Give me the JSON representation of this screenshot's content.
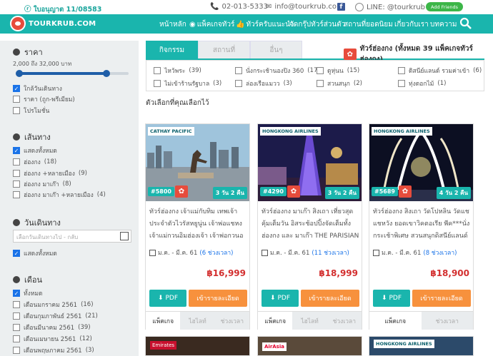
{
  "topbar": {
    "license": "ใบอนุญาต 11/08583",
    "phone": "02-013-5333",
    "email": "info@tourkrub.co",
    "line": "LINE: @tourkrub",
    "add_friends": "Add Friends"
  },
  "nav": {
    "logo_text": "TOURKRUB.COM",
    "items": [
      "หน้าหลัก",
      "แพ็คเกจทัวร์",
      "ทัวร์ครับแนะนำ",
      "จัดกรุ๊ปทัวร์ส่วนตัว",
      "สถานที่ยอดนิยม",
      "เกี่ยวกับเรา",
      "บทความ"
    ]
  },
  "sidebar": {
    "price": {
      "title": "ราคา",
      "range_text": "2,000 ถึง 32,000 บาท",
      "range_min": 2000,
      "range_max": 32000,
      "selected_min": 2000,
      "selected_max": 32000
    },
    "sort_options": [
      {
        "label": "ใกล้วันเดินทาง",
        "checked": true
      },
      {
        "label": "ราคา (ถูก-พรีเมียม)",
        "checked": false
      },
      {
        "label": "โปรโมชั่น",
        "checked": false
      }
    ],
    "route": {
      "title": "เส้นทาง",
      "options": [
        {
          "label": "แสดงทั้งหมด",
          "checked": true
        },
        {
          "label": "ฮ่องกง",
          "count": "(18)",
          "checked": false
        },
        {
          "label": "ฮ่องกง +หลายเมือง",
          "count": "(9)",
          "checked": false
        },
        {
          "label": "ฮ่องกง มาเก๊า",
          "count": "(8)",
          "checked": false
        },
        {
          "label": "ฮ่องกง มาเก๊า +หลายเมือง",
          "count": "(4)",
          "checked": false
        }
      ]
    },
    "date": {
      "title": "วันเดินทาง",
      "placeholder": "เลือกวันเดินทางไป - กลับ",
      "show_all": "แสดงทั้งหมด"
    },
    "month": {
      "title": "เดือน",
      "options": [
        {
          "label": "ทั้งหมด",
          "checked": true
        },
        {
          "label": "เดือนมกราคม 2561",
          "count": "(16)",
          "checked": false
        },
        {
          "label": "เดือนกุมภาพันธ์ 2561",
          "count": "(21)",
          "checked": false
        },
        {
          "label": "เดือนมีนาคม 2561",
          "count": "(39)",
          "checked": false
        },
        {
          "label": "เดือนเมษายน 2561",
          "count": "(12)",
          "checked": false
        },
        {
          "label": "เดือนพฤษภาคม 2561",
          "count": "(3)",
          "checked": false
        }
      ]
    }
  },
  "main": {
    "tabs": [
      "กิจกรรม",
      "สถานที่",
      "อื่นๆ"
    ],
    "heading": "ทัวร์ฮ่องกง (ทั้งหมด 39 แพ็คเกจทัวร์ฮ่องกง)",
    "filters": [
      {
        "label": "ไหว้พระ",
        "count": "(39)"
      },
      {
        "label": "นั่งกระเช้านองปิง 360",
        "count": "(17)"
      },
      {
        "label": "ดูหุ่นน",
        "count": "(15)"
      },
      {
        "label": "ดิสนีย์แลนด์ รวมค่าเข้า",
        "count": "(6)"
      },
      {
        "label": "ไม่เข้าร้านรัฐบาล",
        "count": "(3)"
      },
      {
        "label": "ล่องเรือแมวว",
        "count": "(3)"
      },
      {
        "label": "สวนสนุก",
        "count": "(2)"
      },
      {
        "label": "ทุ่งดอกไม้",
        "count": "(1)"
      }
    ],
    "selected_label": "ตัวเลือกที่คุณเลือกไว้"
  },
  "cards": [
    {
      "code": "#5800",
      "airline": "CATHAY PACIFIC",
      "days": "3 วัน 2 คืน",
      "title": "ทัวร์ฮ่องกง เจ้าแม่กับทิม เทพเจ้าประจำตัวไวรัสหยูนู่น เจ้าพ่อแชหง เจ้าแม่กวนอิมฮ่องเจ้า เจ้าพ่อกวนอ เจ้าแม่กวนอิม...",
      "date_range": "ม.ค. - มี.ค. 61",
      "slots": "(6 ช่วงเวลา)",
      "price": "฿16,999",
      "pdf": "PDF",
      "detail": "เข้ารายละเอียด",
      "tabs": [
        "แพ็คเกจ",
        "ไฮไลท์",
        "ช่วงเวลา"
      ]
    },
    {
      "code": "#4290",
      "airline": "HONGKONG AIRLINES",
      "days": "3 วัน 2 คืน",
      "title": "ทัวร์ฮ่องกง มาเก๊า สิงเถา เที่ยวสุดคุ้มเต็มวัน อิสระช้อปปิ้งจัดเต็มทั้งฮ่องกง และ มาเก๊า THE PARISIAN นมัสการ...",
      "date_range": "ม.ค. - มี.ค. 61",
      "slots": "(11 ช่วงเวลา)",
      "price": "฿18,999",
      "pdf": "PDF",
      "detail": "เข้ารายละเอียด",
      "tabs": [
        "แพ็คเกจ",
        "ไฮไลท์",
        "ช่วงเวลา"
      ]
    },
    {
      "code": "#5689",
      "airline": "HONGKONG AIRLINES",
      "days": "4 วัน 2 คืน",
      "title": "ทัวร์ฮ่องกง สิงเถา วัดโปหลิน วัดแชแชหวัง ยอดเขาวิคตอเรีย พีค***นั่งกระเช้าพิเศษ สวนสนุกดิสนีย์แลนด์ รีสอร์...",
      "date_range": "ม.ค. - มี.ค. 61",
      "slots": "(8 ช่วงเวลา)",
      "price": "฿18,900",
      "pdf": "PDF",
      "detail": "เข้ารายละเอียด",
      "tabs": [
        "แพ็คเกจ",
        "ช่วงเวลา"
      ]
    }
  ],
  "more_cards": [
    {
      "airline": "Emirates"
    },
    {
      "airline": "AirAsia"
    },
    {
      "airline": "HONGKONG AIRLINES"
    }
  ],
  "colors": {
    "teal": "#1ab5ad",
    "orange": "#f7913d",
    "price_red": "#d32f2f",
    "hk_red": "#e74c3c"
  }
}
